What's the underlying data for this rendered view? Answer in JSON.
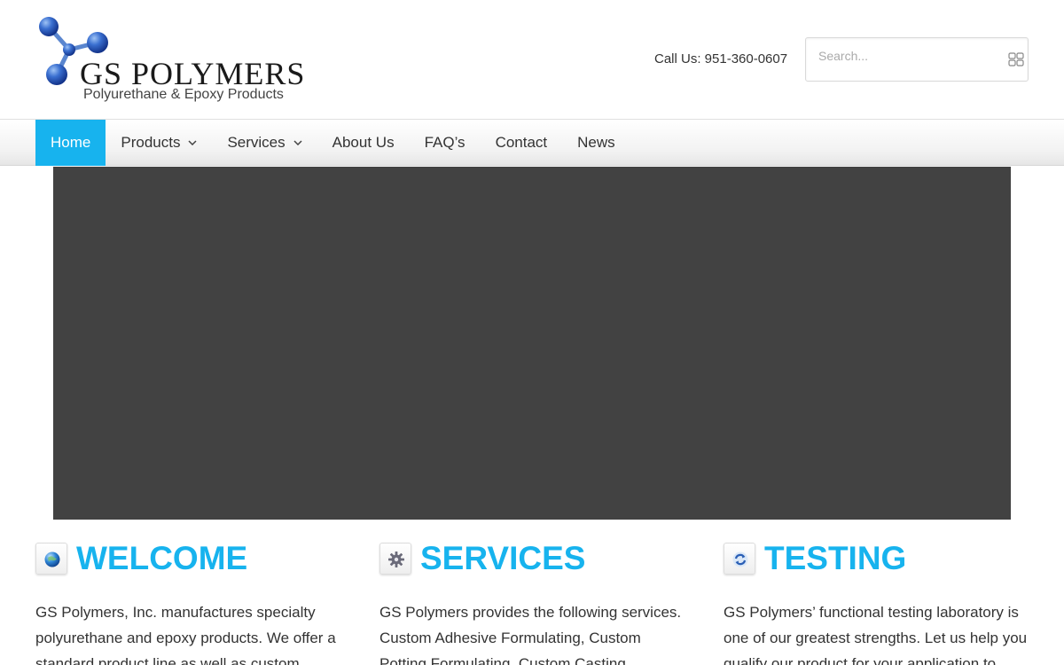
{
  "header": {
    "logo_title": "GS POLYMERS",
    "logo_subtitle": "Polyurethane & Epoxy Products",
    "phone": "Call Us: 951-360-0607",
    "search_placeholder": "Search..."
  },
  "nav": {
    "items": [
      {
        "label": "Home",
        "active": true,
        "dropdown": false
      },
      {
        "label": "Products",
        "active": false,
        "dropdown": true
      },
      {
        "label": "Services",
        "active": false,
        "dropdown": true
      },
      {
        "label": "About Us",
        "active": false,
        "dropdown": false
      },
      {
        "label": "FAQ’s",
        "active": false,
        "dropdown": false
      },
      {
        "label": "Contact",
        "active": false,
        "dropdown": false
      },
      {
        "label": "News",
        "active": false,
        "dropdown": false
      }
    ]
  },
  "columns": [
    {
      "title": "WELCOME",
      "icon": "globe-icon",
      "text": "GS Polymers, Inc. manufactures specialty polyurethane and epoxy products. We offer a standard product line as well as custom"
    },
    {
      "title": "SERVICES",
      "icon": "gear-icon",
      "text": "GS Polymers provides the following services. Custom Adhesive Formulating, Custom Potting Formulating, Custom Casting"
    },
    {
      "title": "TESTING",
      "icon": "recycle-icon",
      "text": "GS Polymers’ functional testing laboratory is one of our greatest strengths. Let us help you qualify our product for your application to"
    }
  ],
  "colors": {
    "accent": "#17b3ee",
    "slider_bg": "#424242"
  }
}
